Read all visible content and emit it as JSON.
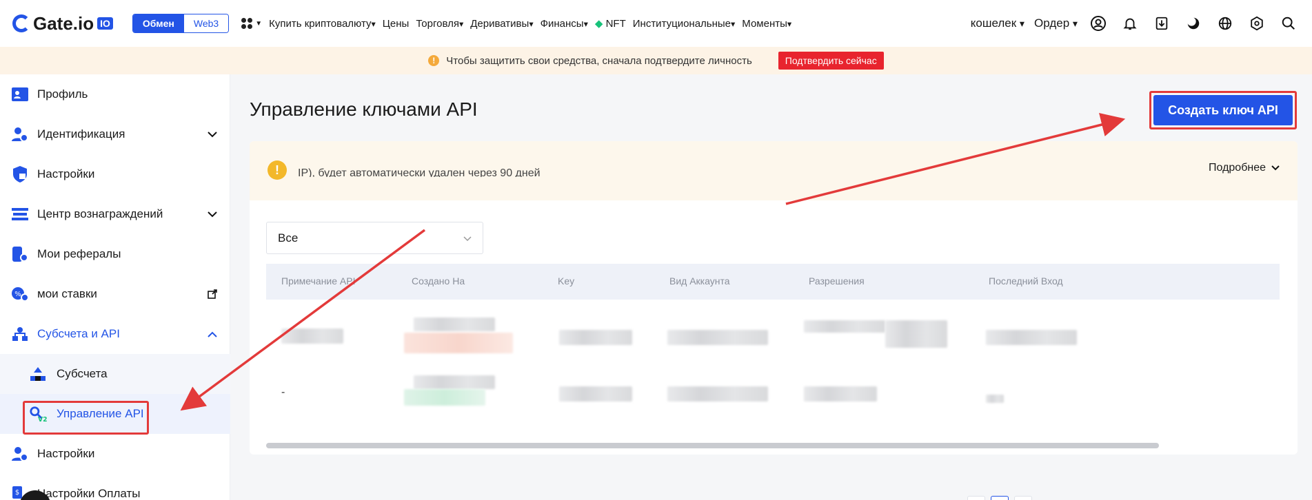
{
  "header": {
    "logo_text": "Gate.io",
    "logo_badge": "IO",
    "switch_exchange": "Обмен",
    "switch_web3": "Web3",
    "nav": [
      "Купить криптовалюту",
      "Цены",
      "Торговля",
      "Деривативы",
      "Финансы",
      "NFT",
      "Институциональные",
      "Моменты"
    ],
    "wallet": "кошелек",
    "orders": "Ордер"
  },
  "notice": {
    "text": "Чтобы защитить свои средства, сначала подтвердите личность",
    "button": "Подтвердить сейчас"
  },
  "sidebar": {
    "items": [
      {
        "label": "Профиль"
      },
      {
        "label": "Идентификация"
      },
      {
        "label": "Настройки"
      },
      {
        "label": "Центр вознаграждений"
      },
      {
        "label": "Мои рефералы"
      },
      {
        "label": "мои ставки"
      },
      {
        "label": "Субсчета и API"
      },
      {
        "label": "Субсчета"
      },
      {
        "label": "Управление API"
      },
      {
        "label": "Настройки"
      },
      {
        "label": "Настройки Оплаты"
      }
    ]
  },
  "main": {
    "title": "Управление ключами API",
    "create_button": "Создать ключ API",
    "tip_text": "IP), будет автоматически удален через 90 дней",
    "tip_more": "Подробнее",
    "filter_value": "Все",
    "columns": [
      "Примечание API",
      "Создано На",
      "Key",
      "Вид Аккаунта",
      "Разрешения",
      "Последний Вход"
    ],
    "rows": [
      {
        "note": ""
      },
      {
        "note": "-"
      }
    ]
  },
  "colors": {
    "brand": "#2354e6",
    "alert": "#e8242e",
    "annotation": "#e33a3a"
  }
}
